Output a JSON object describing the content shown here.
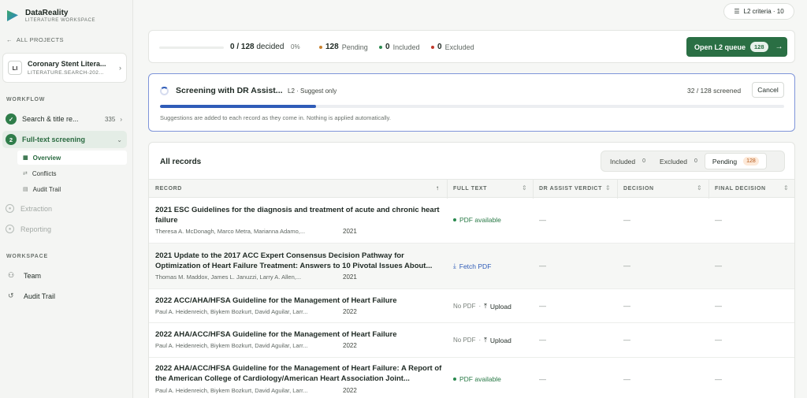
{
  "brand": {
    "name": "DataReality",
    "subtitle": "LITERATURE WORKSPACE"
  },
  "nav": {
    "all_projects": "ALL PROJECTS"
  },
  "project": {
    "avatar": "LI",
    "name": "Coronary Stent Litera...",
    "subtitle": "LITERATURE.SEARCH-202..."
  },
  "workflow": {
    "label": "WORKFLOW",
    "steps": [
      {
        "label": "Search & title re...",
        "count": "335"
      },
      {
        "number": "2",
        "label": "Full-text screening"
      }
    ],
    "substeps": [
      {
        "label": "Overview"
      },
      {
        "label": "Conflicts"
      },
      {
        "label": "Audit Trail"
      }
    ],
    "disabled": [
      {
        "label": "Extraction"
      },
      {
        "label": "Reporting"
      }
    ]
  },
  "workspace": {
    "label": "WORKSPACE",
    "items": [
      {
        "label": "Team"
      },
      {
        "label": "Audit Trail"
      }
    ]
  },
  "topbar": {
    "criteria": "L2 criteria · 10"
  },
  "stats": {
    "decided": "0 / 128",
    "decided_label": "decided",
    "percent": "0%",
    "pending_count": "128",
    "pending_label": "Pending",
    "included_count": "0",
    "included_label": "Included",
    "excluded_count": "0",
    "excluded_label": "Excluded",
    "queue_button": "Open L2 queue",
    "queue_count": "128",
    "colors": {
      "pending": "#c9822e",
      "included": "#2a8a4f",
      "excluded": "#c0392b"
    }
  },
  "assist": {
    "title": "Screening with DR Assist...",
    "mode": "L2 · Suggest only",
    "screened": "32 / 128 screened",
    "progress": 0.25,
    "cancel": "Cancel",
    "note": "Suggestions are added to each record as they come in. Nothing is applied automatically."
  },
  "records": {
    "title": "All records",
    "filters": [
      {
        "label": "Included",
        "count": "0"
      },
      {
        "label": "Excluded",
        "count": "0"
      },
      {
        "label": "Pending",
        "count": "128"
      }
    ],
    "columns": {
      "record": "RECORD",
      "full_text": "FULL TEXT",
      "verdict": "DR ASSIST VERDICT",
      "decision": "DECISION",
      "final": "FINAL DECISION"
    },
    "rows": [
      {
        "title": "2021 ESC Guidelines for the diagnosis and treatment of acute and chronic heart failure",
        "authors": "Theresa A. McDonagh, Marco Metra, Marianna Adamo,...",
        "year": "2021",
        "full_text": "PDF available",
        "verdict": "—",
        "decision": "—",
        "final": "—"
      },
      {
        "title": "2021 Update to the 2017 ACC Expert Consensus Decision Pathway for Optimization of Heart Failure Treatment: Answers to 10 Pivotal Issues About...",
        "authors": "Thomas M. Maddox, James L. Januzzi, Larry A. Allen,...",
        "year": "2021",
        "full_text": "Fetch PDF",
        "verdict": "—",
        "decision": "—",
        "final": "—"
      },
      {
        "title": "2022 ACC/AHA/HFSA Guideline for the Management of Heart Failure",
        "authors": "Paul A. Heidenreich, Biykem Bozkurt, David Aguilar, Larr...",
        "year": "2022",
        "no_pdf": "No PDF",
        "upload": "Upload",
        "verdict": "—",
        "decision": "—",
        "final": "—"
      },
      {
        "title": "2022 AHA/ACC/HFSA Guideline for the Management of Heart Failure",
        "authors": "Paul A. Heidenreich, Biykem Bozkurt, David Aguilar, Larr...",
        "year": "2022",
        "no_pdf": "No PDF",
        "upload": "Upload",
        "verdict": "—",
        "decision": "—",
        "final": "—"
      },
      {
        "title": "2022 AHA/ACC/HFSA Guideline for the Management of Heart Failure: A Report of the American College of Cardiology/American Heart Association Joint...",
        "authors": "Paul A. Heidenreich, Biykem Bozkurt, David Aguilar, Larr...",
        "year": "2022",
        "full_text": "PDF available",
        "verdict": "—",
        "decision": "—",
        "final": "—"
      }
    ]
  }
}
